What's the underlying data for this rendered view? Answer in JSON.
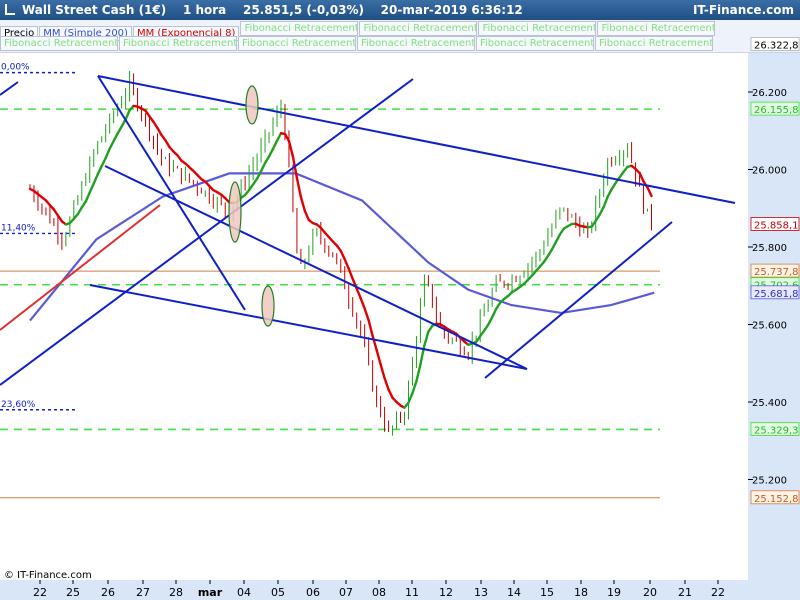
{
  "header": {
    "title": "Wall Street Cash (1€)    1 hora    25.851,5 (-0,03%)    20-mar-2019 6:36:12",
    "brand": "IT-Finance.com"
  },
  "legend": {
    "price_label": "Precio",
    "sma_label": "MM (Simple 200)",
    "ema_label": "MM (Exponencial 8)",
    "fib_label": "Fibonacci Retracement"
  },
  "watermark": "© IT-Finance.com",
  "colors": {
    "up_candle": "#20a020",
    "down_candle": "#c00000",
    "sma": "#5a5ad8",
    "ema_up": "#20a020",
    "ema_down": "#e00000",
    "trendline": "#1020c8",
    "fib_dashed": "#40e040",
    "horizontal_level": "#d08040",
    "ellipse_fill": "#f0c8c0",
    "ellipse_stroke": "#208020"
  },
  "chart_data": {
    "type": "line",
    "title": "Wall Street Cash (1€)",
    "timeframe": "1 hora",
    "last_price": "25.851,5",
    "change": "-0,03%",
    "x_tick_labels": [
      "22",
      "25",
      "26",
      "27",
      "28",
      "mar",
      "04",
      "05",
      "06",
      "07",
      "08",
      "11",
      "12",
      "13",
      "14",
      "15",
      "18",
      "19",
      "20",
      "21",
      "22"
    ],
    "y_tick_labels": [
      "26.200",
      "26.000",
      "25.800",
      "25.600",
      "25.400",
      "25.200"
    ],
    "y_ticks": [
      26200,
      26000,
      25800,
      25600,
      25400,
      25200
    ],
    "ylim": [
      25100,
      26400
    ],
    "price_tags": [
      {
        "label": "26.322,8",
        "value": 26322.8,
        "style": "plain"
      },
      {
        "label": "26.155,8",
        "value": 26155.8,
        "style": "fib"
      },
      {
        "label": "25.858,1",
        "value": 25858.1,
        "style": "price"
      },
      {
        "label": "25.737,8",
        "value": 25737.8,
        "style": "level"
      },
      {
        "label": "25.702,6",
        "value": 25702.6,
        "style": "fib"
      },
      {
        "label": "25.681,8",
        "value": 25681.8,
        "style": "sma"
      },
      {
        "label": "25.329,3",
        "value": 25329.3,
        "style": "fib"
      },
      {
        "label": "25.152,8",
        "value": 25152.8,
        "style": "level"
      }
    ],
    "fib_levels": [
      {
        "label": "0,00%",
        "value": 26250
      },
      {
        "label": "11,40%",
        "value": 25835
      },
      {
        "label": "23,60%",
        "value": 25380
      }
    ],
    "close_series": [
      {
        "x": 0,
        "y": 25950
      },
      {
        "x": 1,
        "y": 25820
      },
      {
        "x": 2,
        "y": 26060
      },
      {
        "x": 3,
        "y": 26220
      },
      {
        "x": 4,
        "y": 26020
      },
      {
        "x": 5,
        "y": 25960
      },
      {
        "x": 6,
        "y": 25890
      },
      {
        "x": 7,
        "y": 26060
      },
      {
        "x": 7.6,
        "y": 26170
      },
      {
        "x": 8.1,
        "y": 25730
      },
      {
        "x": 8.6,
        "y": 25840
      },
      {
        "x": 9.2,
        "y": 25770
      },
      {
        "x": 10,
        "y": 25570
      },
      {
        "x": 10.4,
        "y": 25410
      },
      {
        "x": 10.8,
        "y": 25320
      },
      {
        "x": 11.3,
        "y": 25380
      },
      {
        "x": 11.9,
        "y": 25720
      },
      {
        "x": 12.4,
        "y": 25580
      },
      {
        "x": 13.2,
        "y": 25530
      },
      {
        "x": 14,
        "y": 25700
      },
      {
        "x": 14.6,
        "y": 25720
      },
      {
        "x": 15.3,
        "y": 25780
      },
      {
        "x": 16,
        "y": 25900
      },
      {
        "x": 16.8,
        "y": 25830
      },
      {
        "x": 17.4,
        "y": 26020
      },
      {
        "x": 18,
        "y": 26060
      },
      {
        "x": 18.5,
        "y": 25900
      },
      {
        "x": 18.8,
        "y": 25851
      }
    ],
    "sma_series": [
      {
        "x": 0,
        "y": 25610
      },
      {
        "x": 2,
        "y": 25820
      },
      {
        "x": 4,
        "y": 25930
      },
      {
        "x": 6,
        "y": 25990
      },
      {
        "x": 8,
        "y": 25990
      },
      {
        "x": 10,
        "y": 25920
      },
      {
        "x": 12,
        "y": 25760
      },
      {
        "x": 13.2,
        "y": 25690
      },
      {
        "x": 14.5,
        "y": 25650
      },
      {
        "x": 16,
        "y": 25630
      },
      {
        "x": 17.5,
        "y": 25650
      },
      {
        "x": 18.8,
        "y": 25682
      }
    ]
  }
}
